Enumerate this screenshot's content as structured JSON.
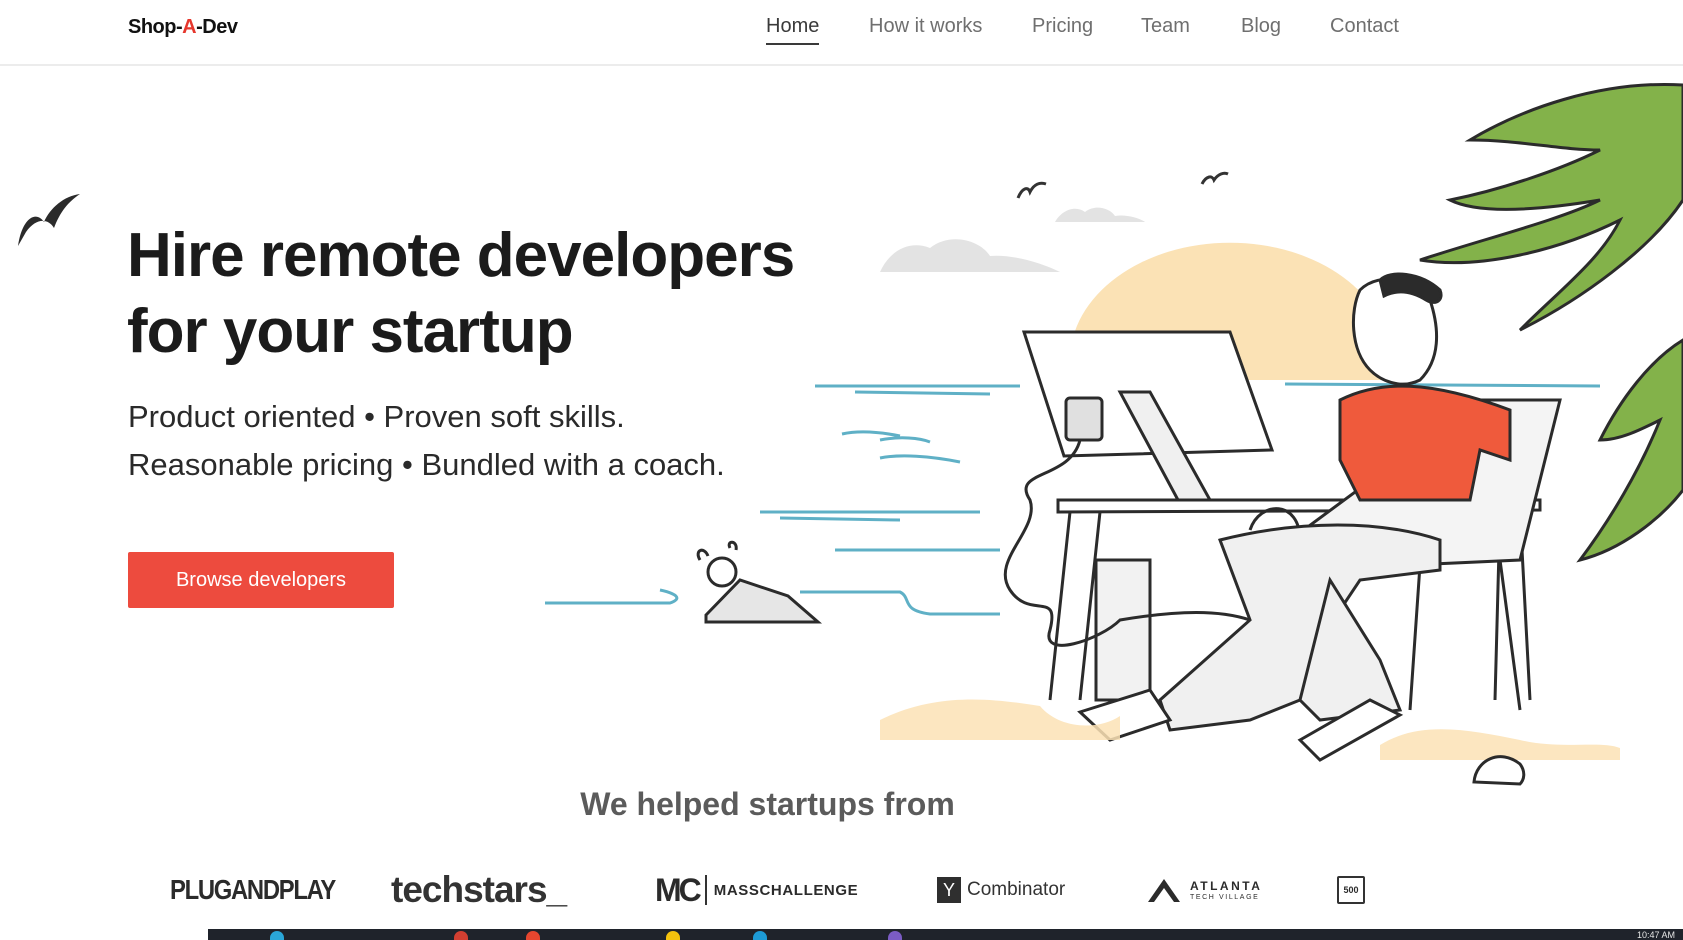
{
  "header": {
    "logo_left": "Shop-",
    "logo_accent": "A",
    "logo_right": "-Dev",
    "nav": [
      {
        "label": "Home",
        "active": true
      },
      {
        "label": "How it works",
        "active": false
      },
      {
        "label": "Pricing",
        "active": false
      },
      {
        "label": "Team",
        "active": false
      },
      {
        "label": "Blog",
        "active": false
      },
      {
        "label": "Contact",
        "active": false
      }
    ]
  },
  "hero": {
    "title_line1": "Hire remote developers",
    "title_line2": "for your startup",
    "subtitle_line1": "Product oriented • Proven soft skills.",
    "subtitle_line2": "Reasonable pricing • Bundled with a coach.",
    "cta_label": "Browse developers"
  },
  "partners": {
    "title": "We helped startups from",
    "plugandplay": "PLUGANDPLAY",
    "techstars": "techstars_",
    "masschallenge_mark": "MC",
    "masschallenge_name": "MASSCHALLENGE",
    "ycombinator_mark": "Y",
    "ycombinator_name": "Combinator",
    "atlanta_line1": "ATLANTA",
    "atlanta_line2": "TECH VILLAGE",
    "fivehundred": "500"
  },
  "taskbar": {
    "clock": "10:47 AM"
  },
  "colors": {
    "accent": "#ed4b3e",
    "logo_accent": "#e6372d",
    "shirt": "#ef5a3c",
    "palm": "#83b24a",
    "sun": "#fbe2b5",
    "water": "#5fb0c6",
    "text_dark": "#1b1b1b",
    "nav_text": "#6f6f6f"
  }
}
